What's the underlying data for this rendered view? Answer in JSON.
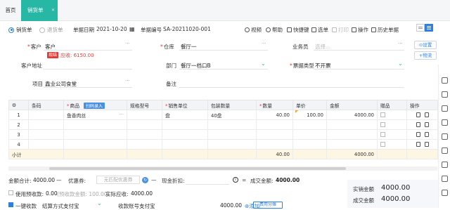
{
  "tabs": {
    "home": "首页",
    "active": "销货单",
    "close": "✕"
  },
  "doc_type": {
    "option1": "销货单",
    "option2": "退货单"
  },
  "header": {
    "date_label": "单据日期",
    "date_value": "2021-10-20",
    "no_label": "单据编号",
    "no_value": "SA-20211020-001"
  },
  "toolbar": {
    "video": "视频",
    "help": "帮助",
    "shortcut": "快捷键",
    "choose": "选单",
    "print": "打印",
    "ops": "操作",
    "history": "历史单据"
  },
  "form": {
    "customer_label": "客户",
    "customer_value": "客户",
    "customer_tag": "现结",
    "customer_debt": "应收: 6150.00",
    "warehouse_label": "仓库",
    "warehouse_value": "餐厅一",
    "salesman_label": "业务员",
    "salesman_placeholder": "选择...",
    "settings_btn": "⊙设置",
    "logistics_btn": "+物流",
    "address_label": "客户地址",
    "dept_label": "部门",
    "dept_value": "餐厅一档口B",
    "invoice_label": "票据类型",
    "invoice_value": "不开票",
    "project_label": "项目",
    "project_value": "鑫业公司食堂",
    "remark_label": "备注"
  },
  "grid": {
    "headers": [
      "条码",
      "商品",
      "规格型号",
      "销售单位",
      "包装数量",
      "数量",
      "单价",
      "金额",
      "赠品",
      "操作"
    ],
    "scan_tag": "扫码录入",
    "rows": [
      {
        "n": "1",
        "barcode": "",
        "product": "鱼香肉丝",
        "spec": "",
        "unit": "盘",
        "pack": "40盘",
        "qty": "40.00",
        "price": "100.00",
        "amount": "4000.00"
      },
      {
        "n": "2",
        "barcode": "",
        "product": "",
        "spec": "",
        "unit": "",
        "pack": "",
        "qty": "",
        "price": "",
        "amount": ""
      },
      {
        "n": "3",
        "barcode": "",
        "product": "",
        "spec": "",
        "unit": "",
        "pack": "",
        "qty": "",
        "price": "",
        "amount": ""
      },
      {
        "n": "4",
        "barcode": "",
        "product": "",
        "spec": "",
        "unit": "",
        "pack": "",
        "qty": "",
        "price": "",
        "amount": ""
      }
    ],
    "subtotal_label": "小计",
    "subtotal_qty": "40.00",
    "subtotal_amount": "4000.00"
  },
  "summary": {
    "total_label": "金额合计:",
    "total_value": "4000.00",
    "coupon_label": "优惠券:",
    "coupon_placeholder": "无匹配优惠券",
    "discount_label": "现金折扣:",
    "discount_value": "",
    "deal_label": "成交金额:",
    "deal_value": "4000.00",
    "prepay_label": "使用预收款:",
    "prepay_value": "0.00",
    "prepay_hint": "(预收款金额: 100.00)",
    "receivable_label": "实际应收:",
    "receivable_value": "4000.00",
    "one_key": "一键收款",
    "settle_label": "结算方式",
    "settle_value": "支付宝",
    "account_label": "收款账号",
    "account_value": "支付宝",
    "pay_amount": "4000.00",
    "add_label": "添加",
    "split_btn": "费用分摊",
    "sales_amount_label": "实销金额",
    "sales_amount_value": "4000.00",
    "deal_total_label": "成交金额",
    "deal_total_value": "4000.00"
  },
  "colors": {
    "accent": "#27b7a5",
    "blue": "#2f7fe0",
    "danger": "#e53935"
  }
}
